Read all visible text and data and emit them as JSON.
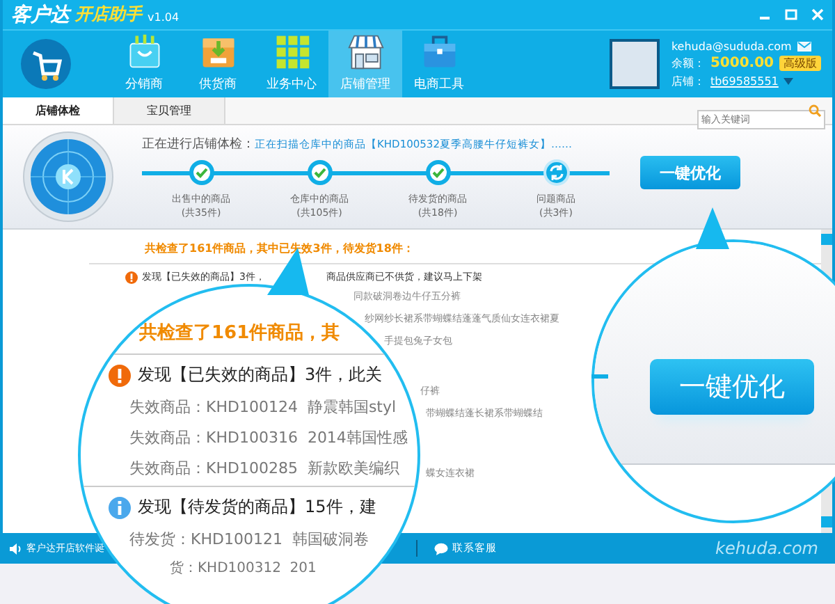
{
  "window": {
    "brand": "客户达",
    "product": "开店助手",
    "version": "v1.04"
  },
  "nav": [
    {
      "label": "分销商",
      "kind": "bag",
      "selected": false
    },
    {
      "label": "供货商",
      "kind": "box",
      "selected": false
    },
    {
      "label": "业务中心",
      "kind": "grid",
      "selected": false
    },
    {
      "label": "店铺管理",
      "kind": "store",
      "selected": true
    },
    {
      "label": "电商工具",
      "kind": "toolbox",
      "selected": false
    }
  ],
  "account": {
    "email": "kehuda@sududa.com",
    "balance_label": "余额：",
    "balance": "5000.00",
    "badge": "高级版",
    "shop_label": "店铺：",
    "shop": "tb69585551"
  },
  "tabs": [
    {
      "label": "店铺体检",
      "selected": true
    },
    {
      "label": "宝贝管理",
      "selected": false
    }
  ],
  "search": {
    "placeholder": "输入关键词"
  },
  "scan": {
    "label": "正在进行店铺体检：",
    "current": "正在扫描仓库中的商品【KHD100532夏季高腰牛仔短裤女】……",
    "steps": [
      {
        "label": "出售中的商品",
        "count": "(共35件)",
        "done": true
      },
      {
        "label": "仓库中的商品",
        "count": "(共105件)",
        "done": true
      },
      {
        "label": "待发货的商品",
        "count": "(共18件)",
        "done": true
      },
      {
        "label": "问题商品",
        "count": "(共3件)",
        "done": false
      }
    ],
    "button": "一键优化"
  },
  "summary": "共检查了161件商品，其中已失效3件，待发货18件：",
  "list": {
    "title": "发现【已失效的商品】3件，",
    "title_rest": "商品供应商已不供货，建议马上下架",
    "fragments": [
      "同款破洞卷边牛仔五分裤",
      "纱网纱长裙系带蝴蝶结蓬蓬气质仙女连衣裙夏",
      "手提包兔子女包",
      "仔裤",
      "带蝴蝶结蓬长裙系带蝴蝶结",
      "蝶女连衣裙"
    ]
  },
  "status_bar": {
    "notice": "客户达开店软件诞",
    "contact": "联系客服",
    "site": "kehuda.com"
  },
  "magnifier_left": {
    "summary": "共检查了161件商品，其",
    "groups": [
      {
        "kind": "warning",
        "title": "发现【已失效的商品】3件，此关",
        "items": [
          "失效商品：KHD100124  静震韩国styl",
          "失效商品：KHD100316  2014韩国性感",
          "失效商品：KHD100285  新款欧美编织"
        ]
      },
      {
        "kind": "info",
        "title": "发现【待发货的商品】15件，建",
        "items": [
          "待发货：KHD100121  韩国破洞卷",
          "货：KHD100312  201"
        ]
      }
    ]
  },
  "magnifier_right": {
    "button": "一键优化"
  }
}
